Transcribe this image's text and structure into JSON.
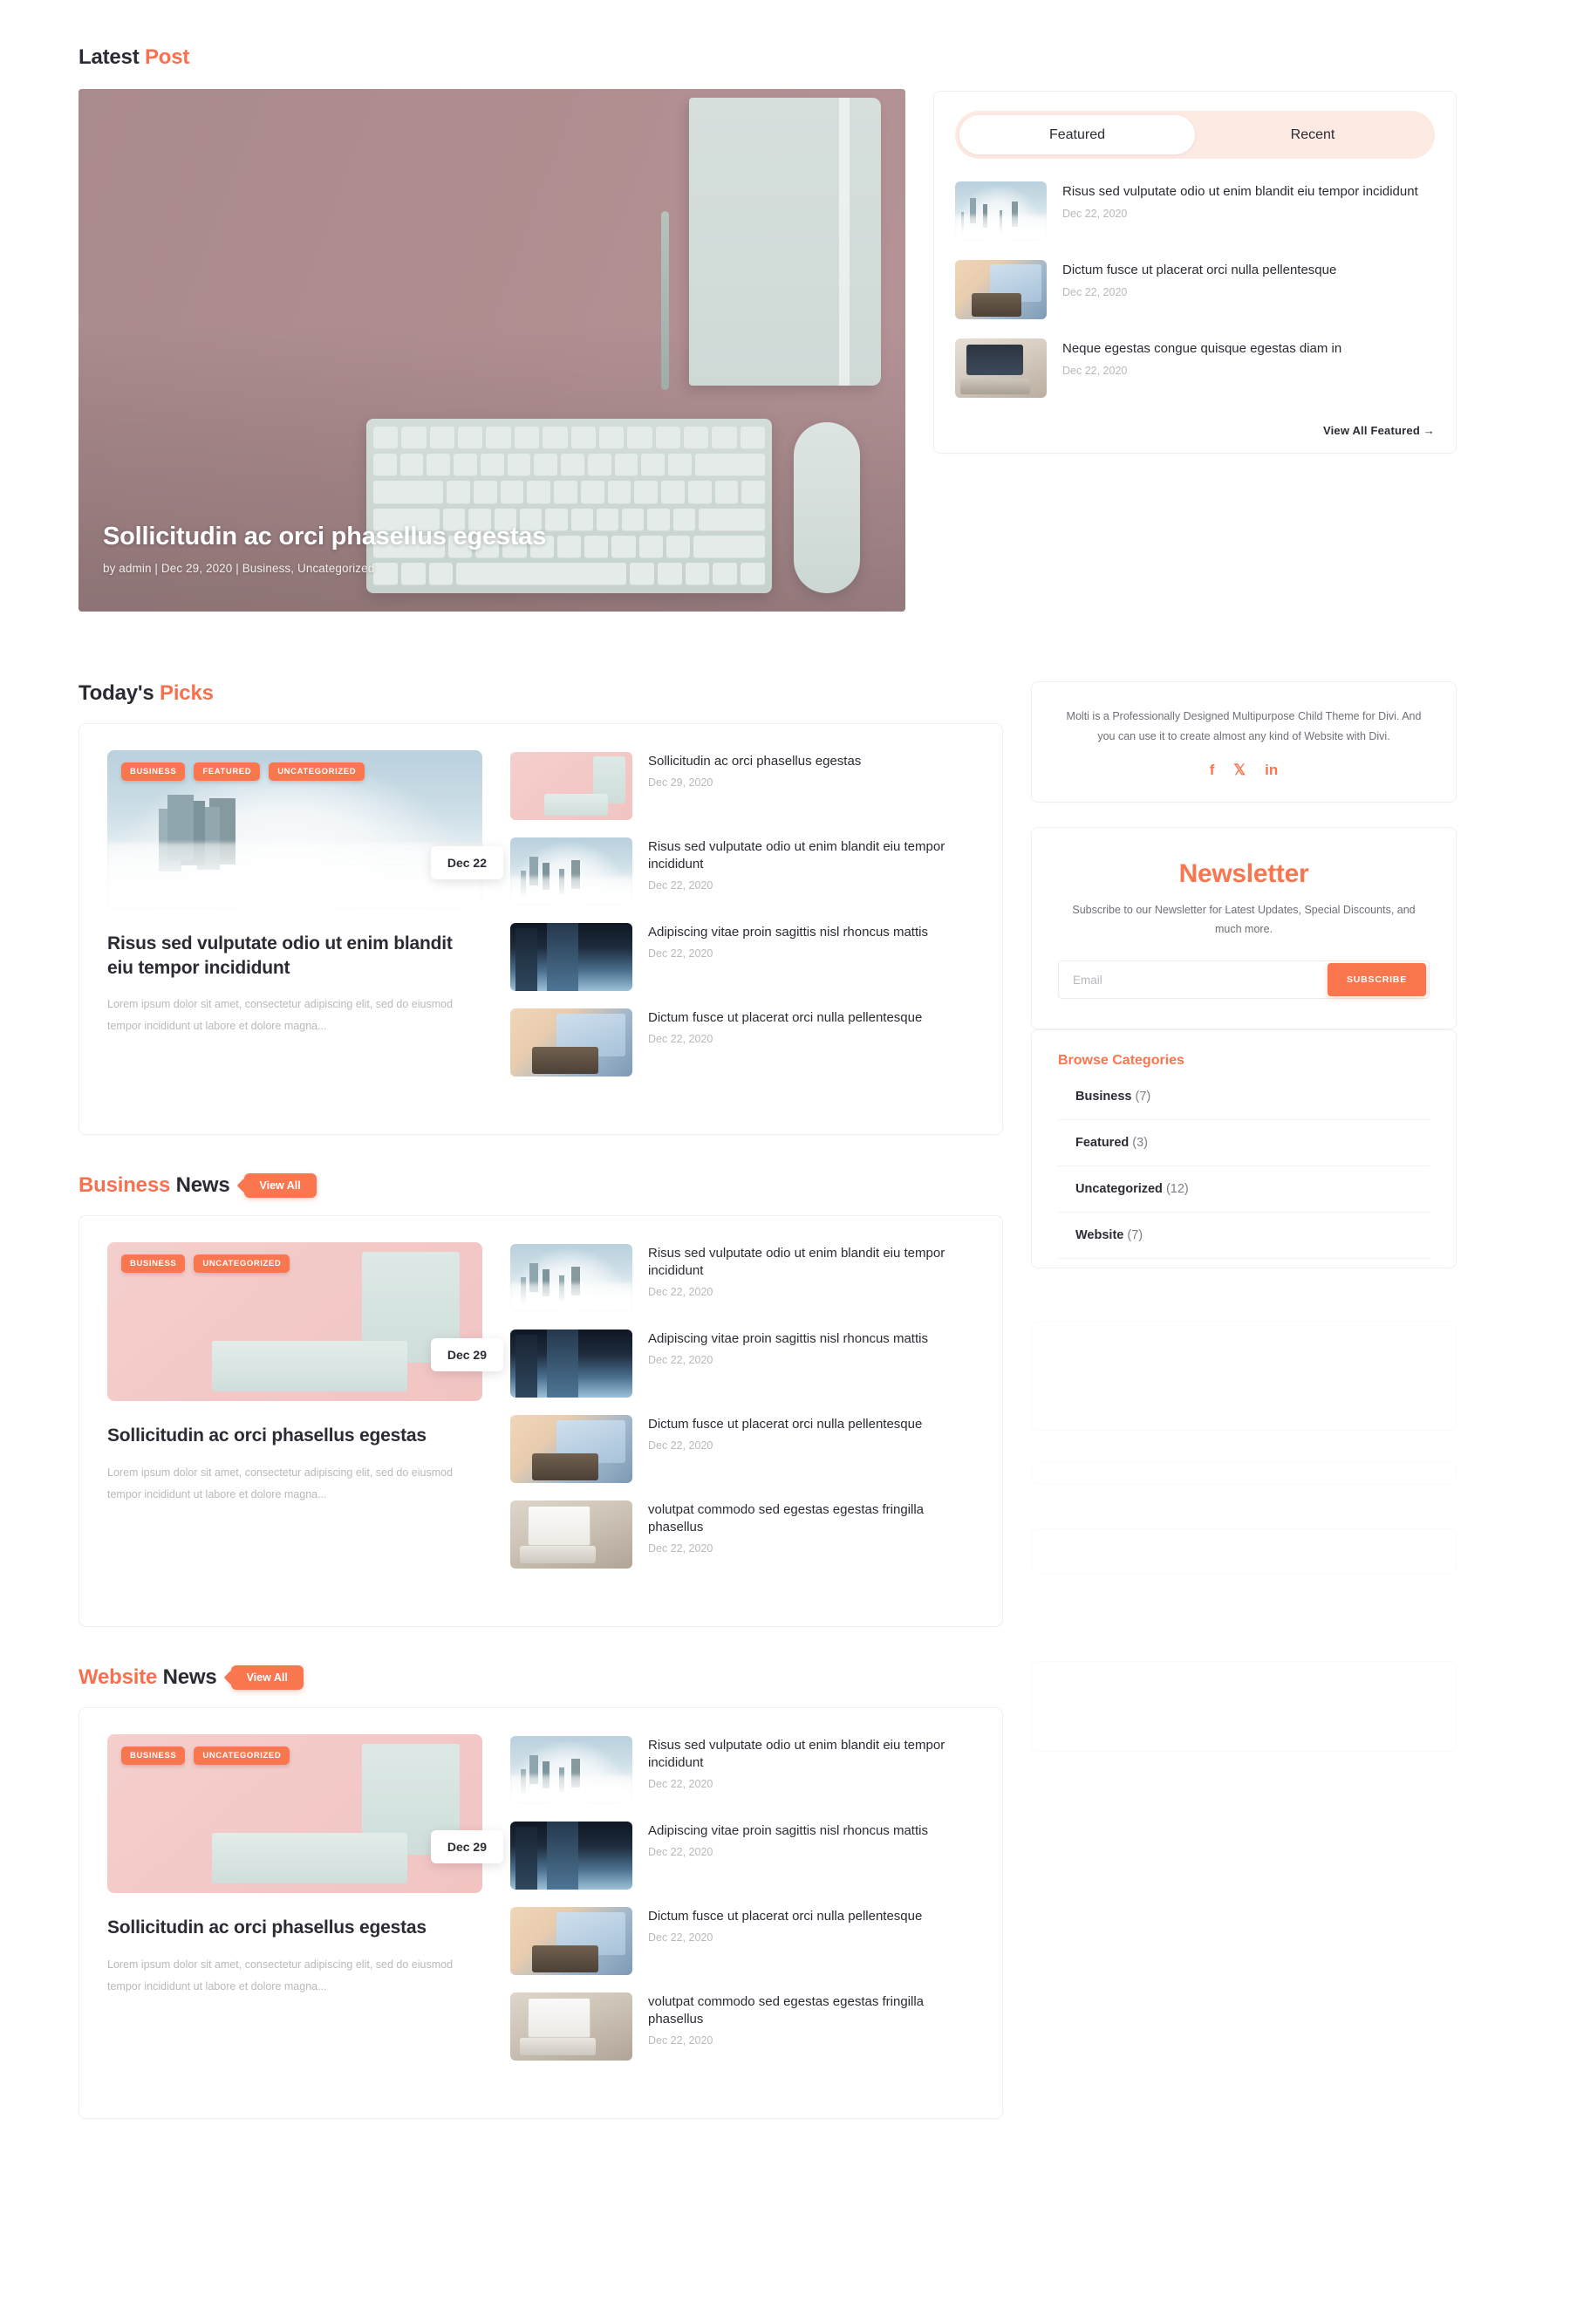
{
  "latest": {
    "heading_dark": "Latest",
    "heading_accent": "Post",
    "hero": {
      "title": "Sollicitudin ac orci phasellus egestas",
      "meta": "by admin | Dec 29, 2020 | Business, Uncategorized"
    }
  },
  "featured_widget": {
    "tabs": [
      {
        "label": "Featured",
        "active": true
      },
      {
        "label": "Recent",
        "active": false
      }
    ],
    "items": [
      {
        "title": "Risus sed vulputate odio ut enim blandit eiu tempor incididunt",
        "date": "Dec 22, 2020",
        "art": "art-city"
      },
      {
        "title": "Dictum fusce ut placerat orci nulla pellentesque",
        "date": "Dec 22, 2020",
        "art": "art-tablet"
      },
      {
        "title": "Neque egestas congue quisque egestas diam in",
        "date": "Dec 22, 2020",
        "art": "art-laptop"
      }
    ],
    "view_all": "View All Featured →"
  },
  "sections": [
    {
      "heading_dark": "Today's",
      "heading_accent": "Picks",
      "accent_first": false,
      "has_view_all": false,
      "view_all_label": "",
      "feature": {
        "badges": [
          "BUSINESS",
          "FEATURED",
          "UNCATEGORIZED"
        ],
        "date_chip": "Dec 22",
        "art": "art-city",
        "title": "Risus sed vulputate odio ut enim blandit eiu tempor incididunt",
        "excerpt": "Lorem ipsum dolor sit amet, consectetur adipiscing elit, sed do eiusmod tempor incididunt ut labore et dolore magna..."
      },
      "list": [
        {
          "title": "Sollicitudin ac orci phasellus egestas",
          "date": "Dec 29, 2020",
          "art": "art-desk"
        },
        {
          "title": "Risus sed vulputate odio ut enim blandit eiu tempor incididunt",
          "date": "Dec 22, 2020",
          "art": "art-city"
        },
        {
          "title": "Adipiscing vitae proin sagittis nisl rhoncus mattis",
          "date": "Dec 22, 2020",
          "art": "art-tower"
        },
        {
          "title": "Dictum fusce ut placerat orci nulla pellentesque",
          "date": "Dec 22, 2020",
          "art": "art-tablet"
        }
      ]
    },
    {
      "heading_dark": "News",
      "heading_accent": "Business",
      "accent_first": true,
      "has_view_all": true,
      "view_all_label": "View All",
      "feature": {
        "badges": [
          "BUSINESS",
          "UNCATEGORIZED"
        ],
        "date_chip": "Dec 29",
        "art": "art-desk",
        "title": "Sollicitudin ac orci phasellus egestas",
        "excerpt": "Lorem ipsum dolor sit amet, consectetur adipiscing elit, sed do eiusmod tempor incididunt ut labore et dolore magna..."
      },
      "list": [
        {
          "title": "Risus sed vulputate odio ut enim blandit eiu tempor incididunt",
          "date": "Dec 22, 2020",
          "art": "art-city"
        },
        {
          "title": "Adipiscing vitae proin sagittis nisl rhoncus mattis",
          "date": "Dec 22, 2020",
          "art": "art-tower"
        },
        {
          "title": "Dictum fusce ut placerat orci nulla pellentesque",
          "date": "Dec 22, 2020",
          "art": "art-tablet"
        },
        {
          "title": "volutpat commodo sed egestas egestas fringilla phasellus",
          "date": "Dec 22, 2020",
          "art": "art-whitelap"
        }
      ]
    },
    {
      "heading_dark": "News",
      "heading_accent": "Website",
      "accent_first": true,
      "has_view_all": true,
      "view_all_label": "View All",
      "feature": {
        "badges": [
          "BUSINESS",
          "UNCATEGORIZED"
        ],
        "date_chip": "Dec 29",
        "art": "art-desk",
        "title": "Sollicitudin ac orci phasellus egestas",
        "excerpt": "Lorem ipsum dolor sit amet, consectetur adipiscing elit, sed do eiusmod tempor incididunt ut labore et dolore magna..."
      },
      "list": [
        {
          "title": "Risus sed vulputate odio ut enim blandit eiu tempor incididunt",
          "date": "Dec 22, 2020",
          "art": "art-city"
        },
        {
          "title": "Adipiscing vitae proin sagittis nisl rhoncus mattis",
          "date": "Dec 22, 2020",
          "art": "art-tower"
        },
        {
          "title": "Dictum fusce ut placerat orci nulla pellentesque",
          "date": "Dec 22, 2020",
          "art": "art-tablet"
        },
        {
          "title": "volutpat commodo sed egestas egestas fringilla phasellus",
          "date": "Dec 22, 2020",
          "art": "art-whitelap"
        }
      ]
    }
  ],
  "sidebar": {
    "about": {
      "text": "Molti is a Professionally Designed Multipurpose Child Theme for Divi. And you can use it to create almost any kind of Website with Divi.",
      "socials": [
        {
          "name": "facebook-icon",
          "glyph": "f"
        },
        {
          "name": "x-twitter-icon",
          "glyph": "𝕏"
        },
        {
          "name": "linkedin-icon",
          "glyph": "in"
        }
      ]
    },
    "newsletter": {
      "title": "Newsletter",
      "subtitle": "Subscribe to our Newsletter for Latest Updates, Special Discounts, and much more.",
      "email_placeholder": "Email",
      "email_value": "",
      "button_label": "SUBSCRIBE"
    },
    "categories": {
      "title": "Browse Categories",
      "items": [
        {
          "label": "Business",
          "count": "(7)"
        },
        {
          "label": "Featured",
          "count": "(3)"
        },
        {
          "label": "Uncategorized",
          "count": "(12)"
        },
        {
          "label": "Website",
          "count": "(7)"
        }
      ]
    }
  },
  "colors": {
    "accent": "#f9764f",
    "accent_soft": "#fdeae3",
    "text": "#2b2b34",
    "muted": "#b9b9bd"
  }
}
